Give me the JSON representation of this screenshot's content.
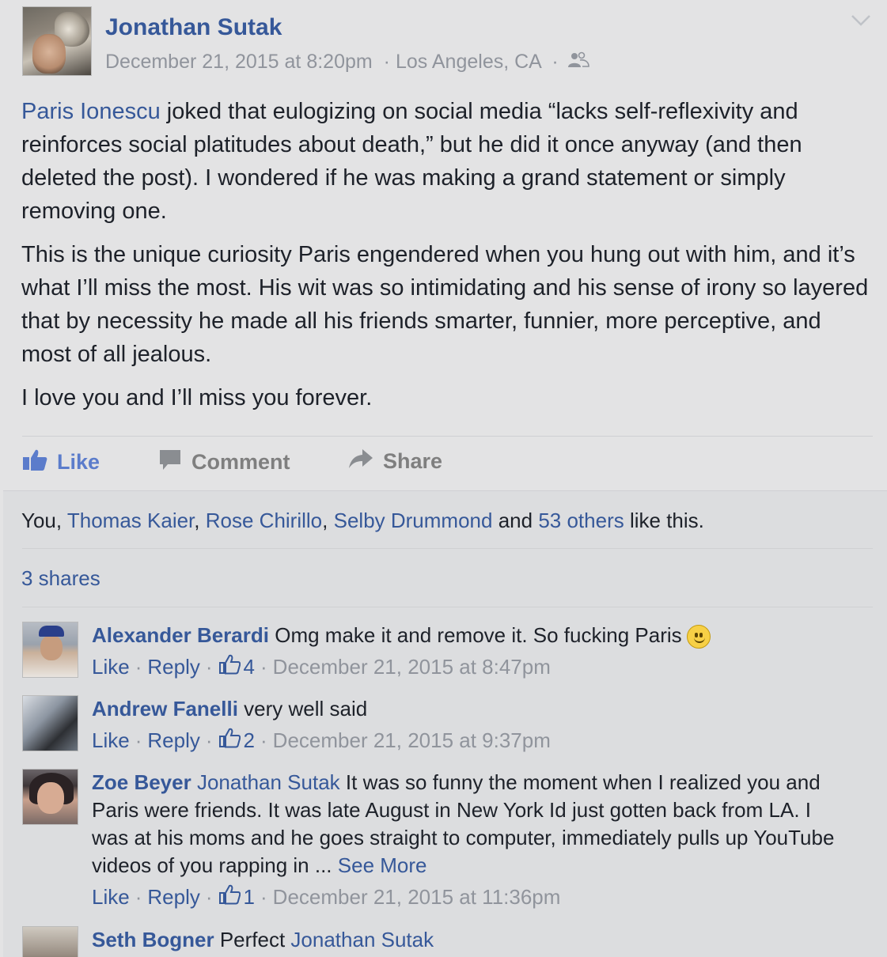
{
  "post": {
    "author": "Jonathan Sutak",
    "timestamp": "December 21, 2015 at 8:20pm",
    "location": "Los Angeles, CA",
    "separator": "·",
    "audience_icon": "friends-icon",
    "menu_icon": "chevron-down-icon",
    "body": {
      "mention": "Paris Ionescu",
      "p1_rest": " joked that eulogizing on social media “lacks self-reflexivity and reinforces social platitudes about death,” but he did it once anyway (and then deleted the post). I wondered if he was making a grand statement or simply removing one.",
      "p2": "This is the unique curiosity Paris engendered when you hung out with him, and it’s what I’ll miss the most. His wit was so intimidating and his sense of irony so layered that by necessity he made all his friends smarter, funnier, more perceptive, and most of all jealous.",
      "p3": "I love you and I’ll miss you forever."
    }
  },
  "actions": {
    "like": "Like",
    "comment": "Comment",
    "share": "Share"
  },
  "likes": {
    "you": "You,",
    "names": [
      "Thomas Kaier",
      "Rose Chirillo",
      "Selby Drummond"
    ],
    "comma": ",",
    "and": "and",
    "others": "53 others",
    "suffix": "like this."
  },
  "shares": "3 shares",
  "comments": [
    {
      "name": "Alexander Berardi",
      "text": "Omg make it and remove it. So fucking Paris",
      "emoji": "smiley-emoji",
      "like": "Like",
      "reply": "Reply",
      "count": "4",
      "time": "December 21, 2015 at 8:47pm"
    },
    {
      "name": "Andrew Fanelli",
      "text": "very well said",
      "like": "Like",
      "reply": "Reply",
      "count": "2",
      "time": "December 21, 2015 at 9:37pm"
    },
    {
      "name": "Zoe Beyer",
      "mention": "Jonathan Sutak",
      "text": "It was so funny the moment when I realized you and Paris were friends. It was late August in New York Id just gotten back from LA. I was at his moms and he goes straight to computer, immediately pulls up YouTube videos of you rapping in ...",
      "see_more": "See More",
      "like": "Like",
      "reply": "Reply",
      "count": "1",
      "time": "December 21, 2015 at 11:36pm"
    },
    {
      "name": "Seth Bogner",
      "text": "Perfect",
      "mention": "Jonathan Sutak"
    }
  ],
  "colors": {
    "link": "#365899",
    "meta": "#90949c",
    "background": "#e3e3e4"
  }
}
